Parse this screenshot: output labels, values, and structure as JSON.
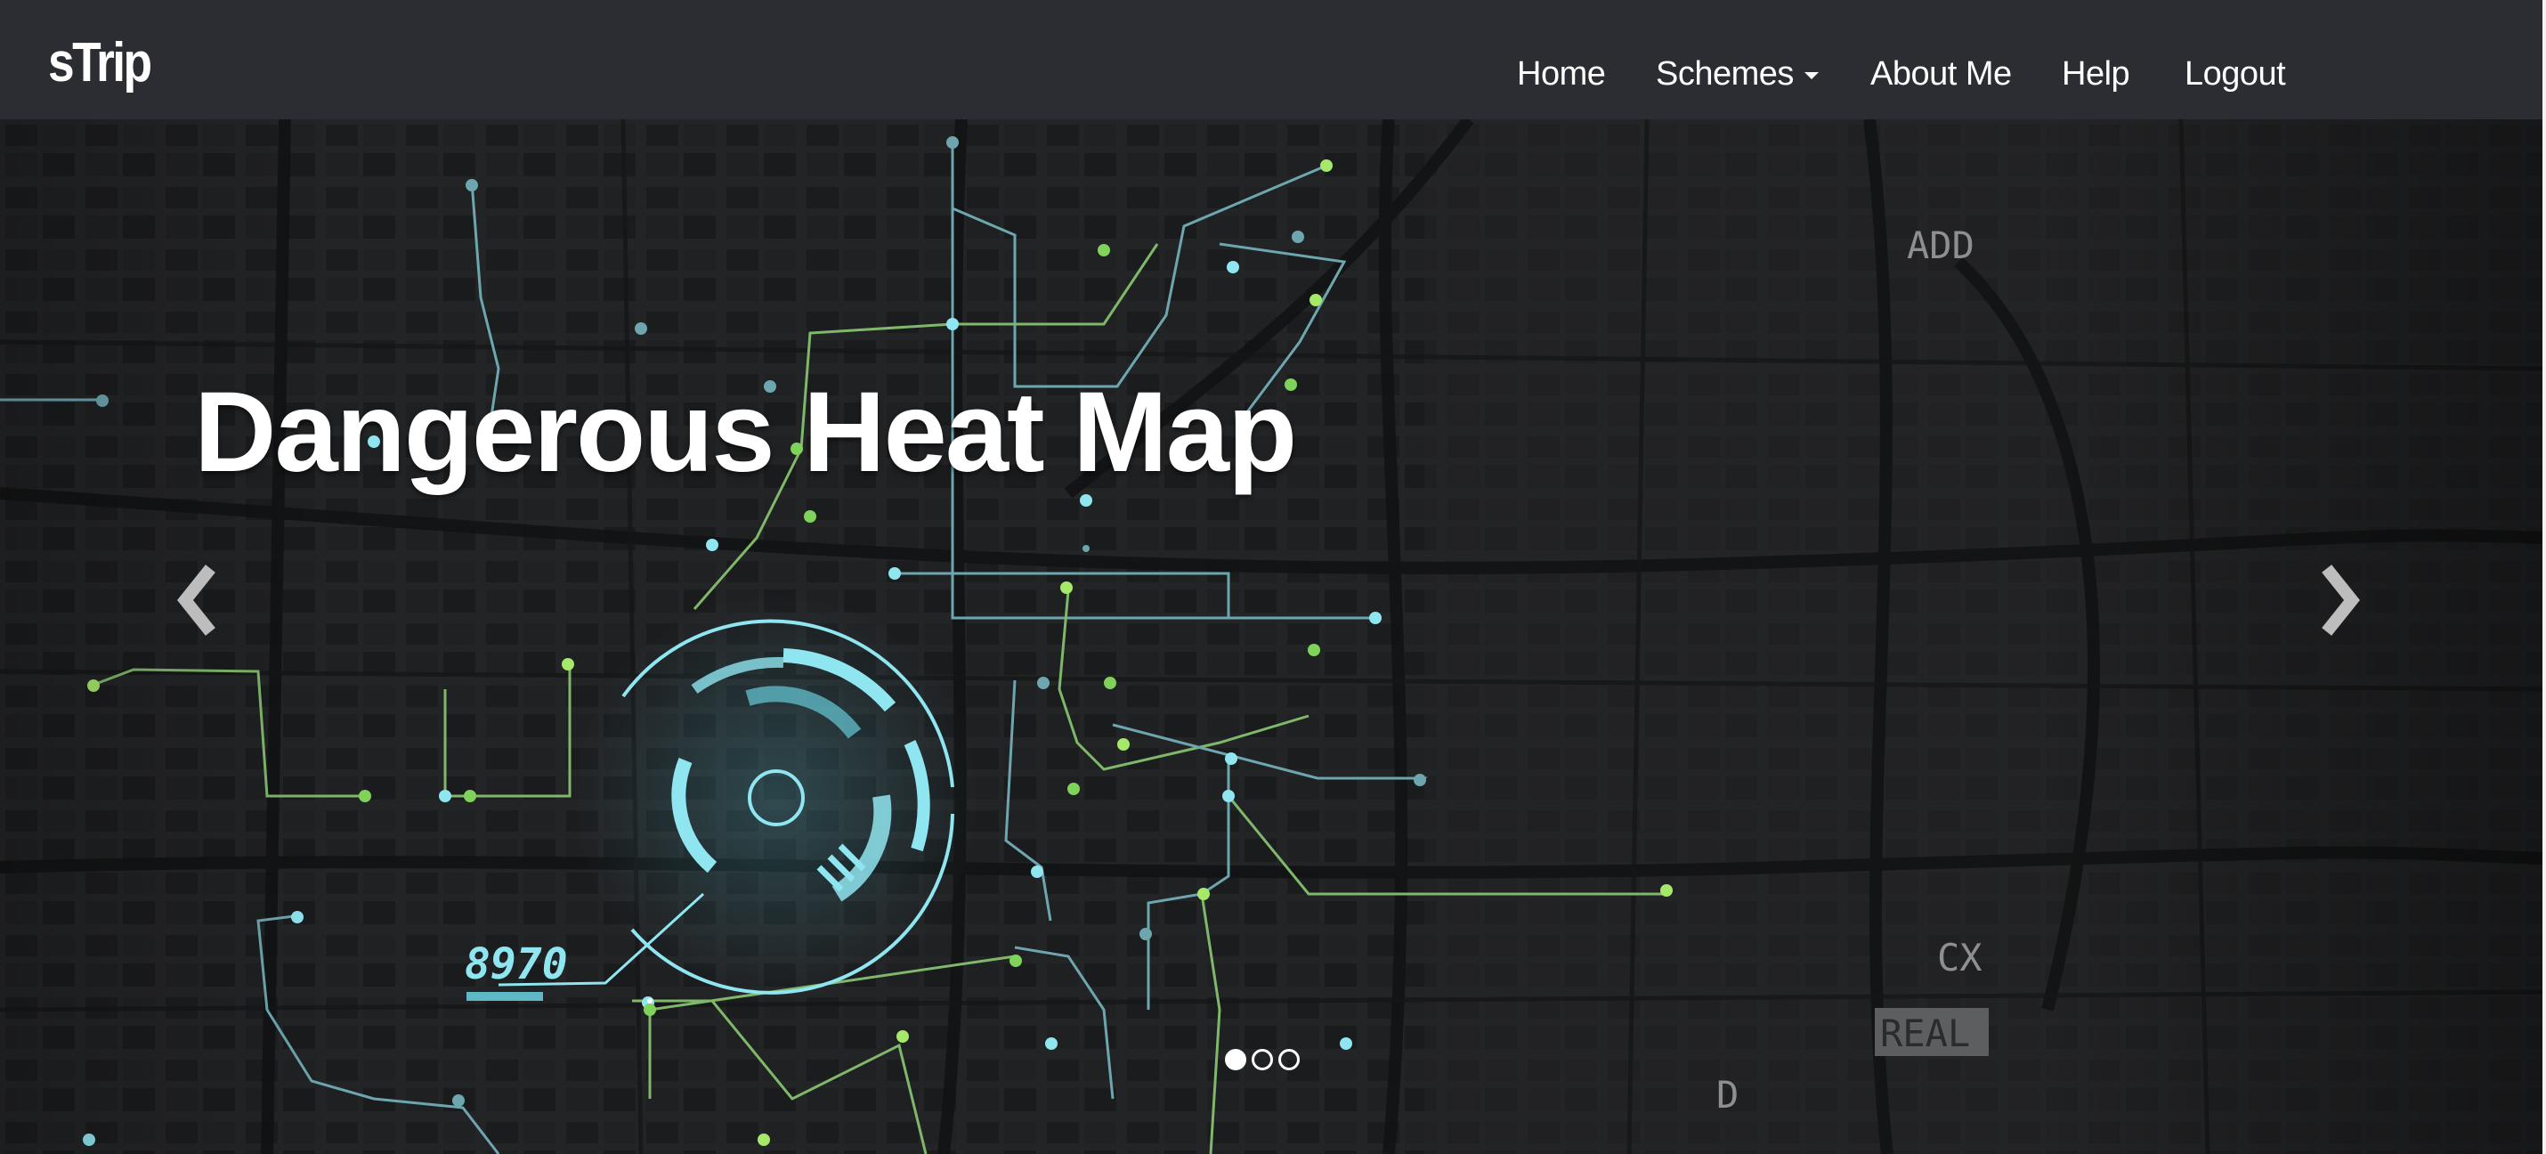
{
  "navbar": {
    "brand": "sTrip",
    "items": [
      {
        "label": "Home"
      },
      {
        "label": "Schemes",
        "has_dropdown": true
      },
      {
        "label": "About Me"
      },
      {
        "label": "Help"
      },
      {
        "label": "Logout"
      }
    ]
  },
  "carousel": {
    "headline": "Dangerous Heat Map",
    "slide_count": 3,
    "active_slide": 1,
    "map_labels": {
      "counter": "8970",
      "add": "ADD",
      "cx": "CX",
      "real": "REAL",
      "d": "D"
    }
  },
  "icons": {
    "prev": "chevron-left-icon",
    "next": "chevron-right-icon",
    "dropdown": "caret-down-icon"
  },
  "colors": {
    "navbar_bg": "#2b2d33",
    "map_bg": "#1e1f21",
    "route_cyan": "#5fd6e6",
    "route_green": "#7fd35a",
    "text": "#ffffff"
  }
}
